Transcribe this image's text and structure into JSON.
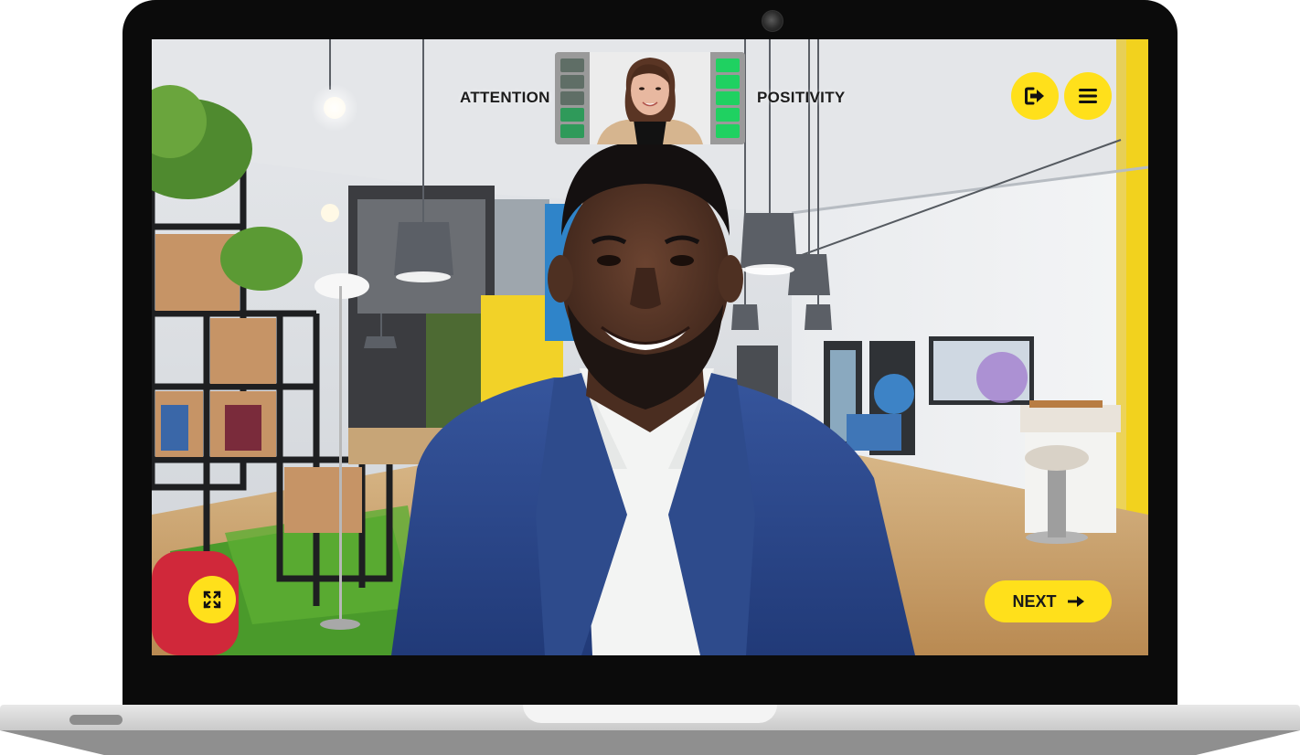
{
  "meters": {
    "attention_label": "ATTENTION",
    "positivity_label": "POSITIVITY",
    "attention_level": 0.4,
    "positivity_level": 1.0,
    "attention_color": "#2f9a5a",
    "positivity_color": "#1fd161"
  },
  "controls": {
    "exit_icon": "exit-arrow-icon",
    "menu_icon": "hamburger-menu-icon",
    "fullscreen_icon": "expand-icon",
    "next_label": "NEXT",
    "next_icon": "arrow-right-icon",
    "accent_color": "#ffe01b"
  }
}
